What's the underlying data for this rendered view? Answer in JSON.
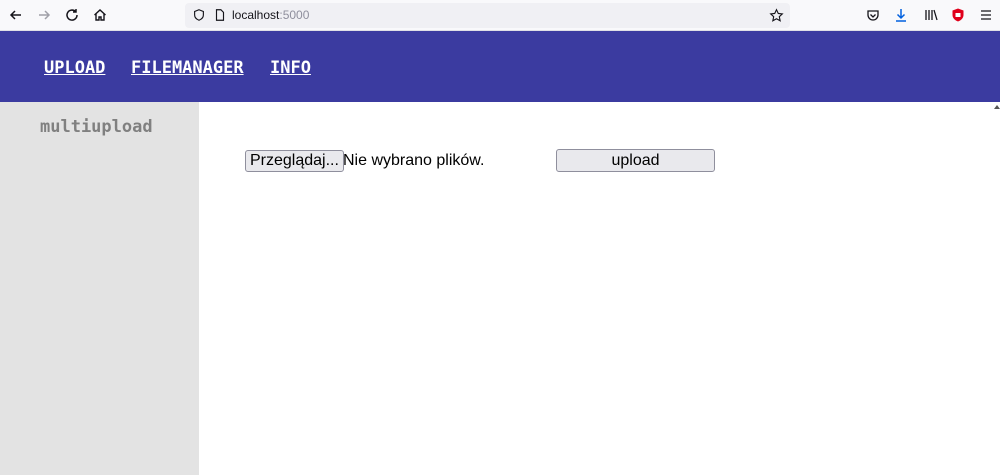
{
  "browser": {
    "url_host": "localhost",
    "url_port": ":5000",
    "icons": [
      "back-icon",
      "forward-icon",
      "reload-icon",
      "home-icon",
      "shield-icon",
      "page-icon",
      "star-icon",
      "pocket-icon",
      "download-icon",
      "library-icon",
      "extension-icon",
      "menu-icon"
    ]
  },
  "header": {
    "nav": [
      {
        "label": "UPLOAD"
      },
      {
        "label": "FILEMANAGER"
      },
      {
        "label": "INFO"
      }
    ],
    "color": "#3b3ba0"
  },
  "sidebar": {
    "items": [
      {
        "label": "multiupload"
      }
    ]
  },
  "main": {
    "file_button_label": "Przeglądaj...",
    "file_status": "Nie wybrano plików.",
    "upload_button_label": "upload"
  }
}
